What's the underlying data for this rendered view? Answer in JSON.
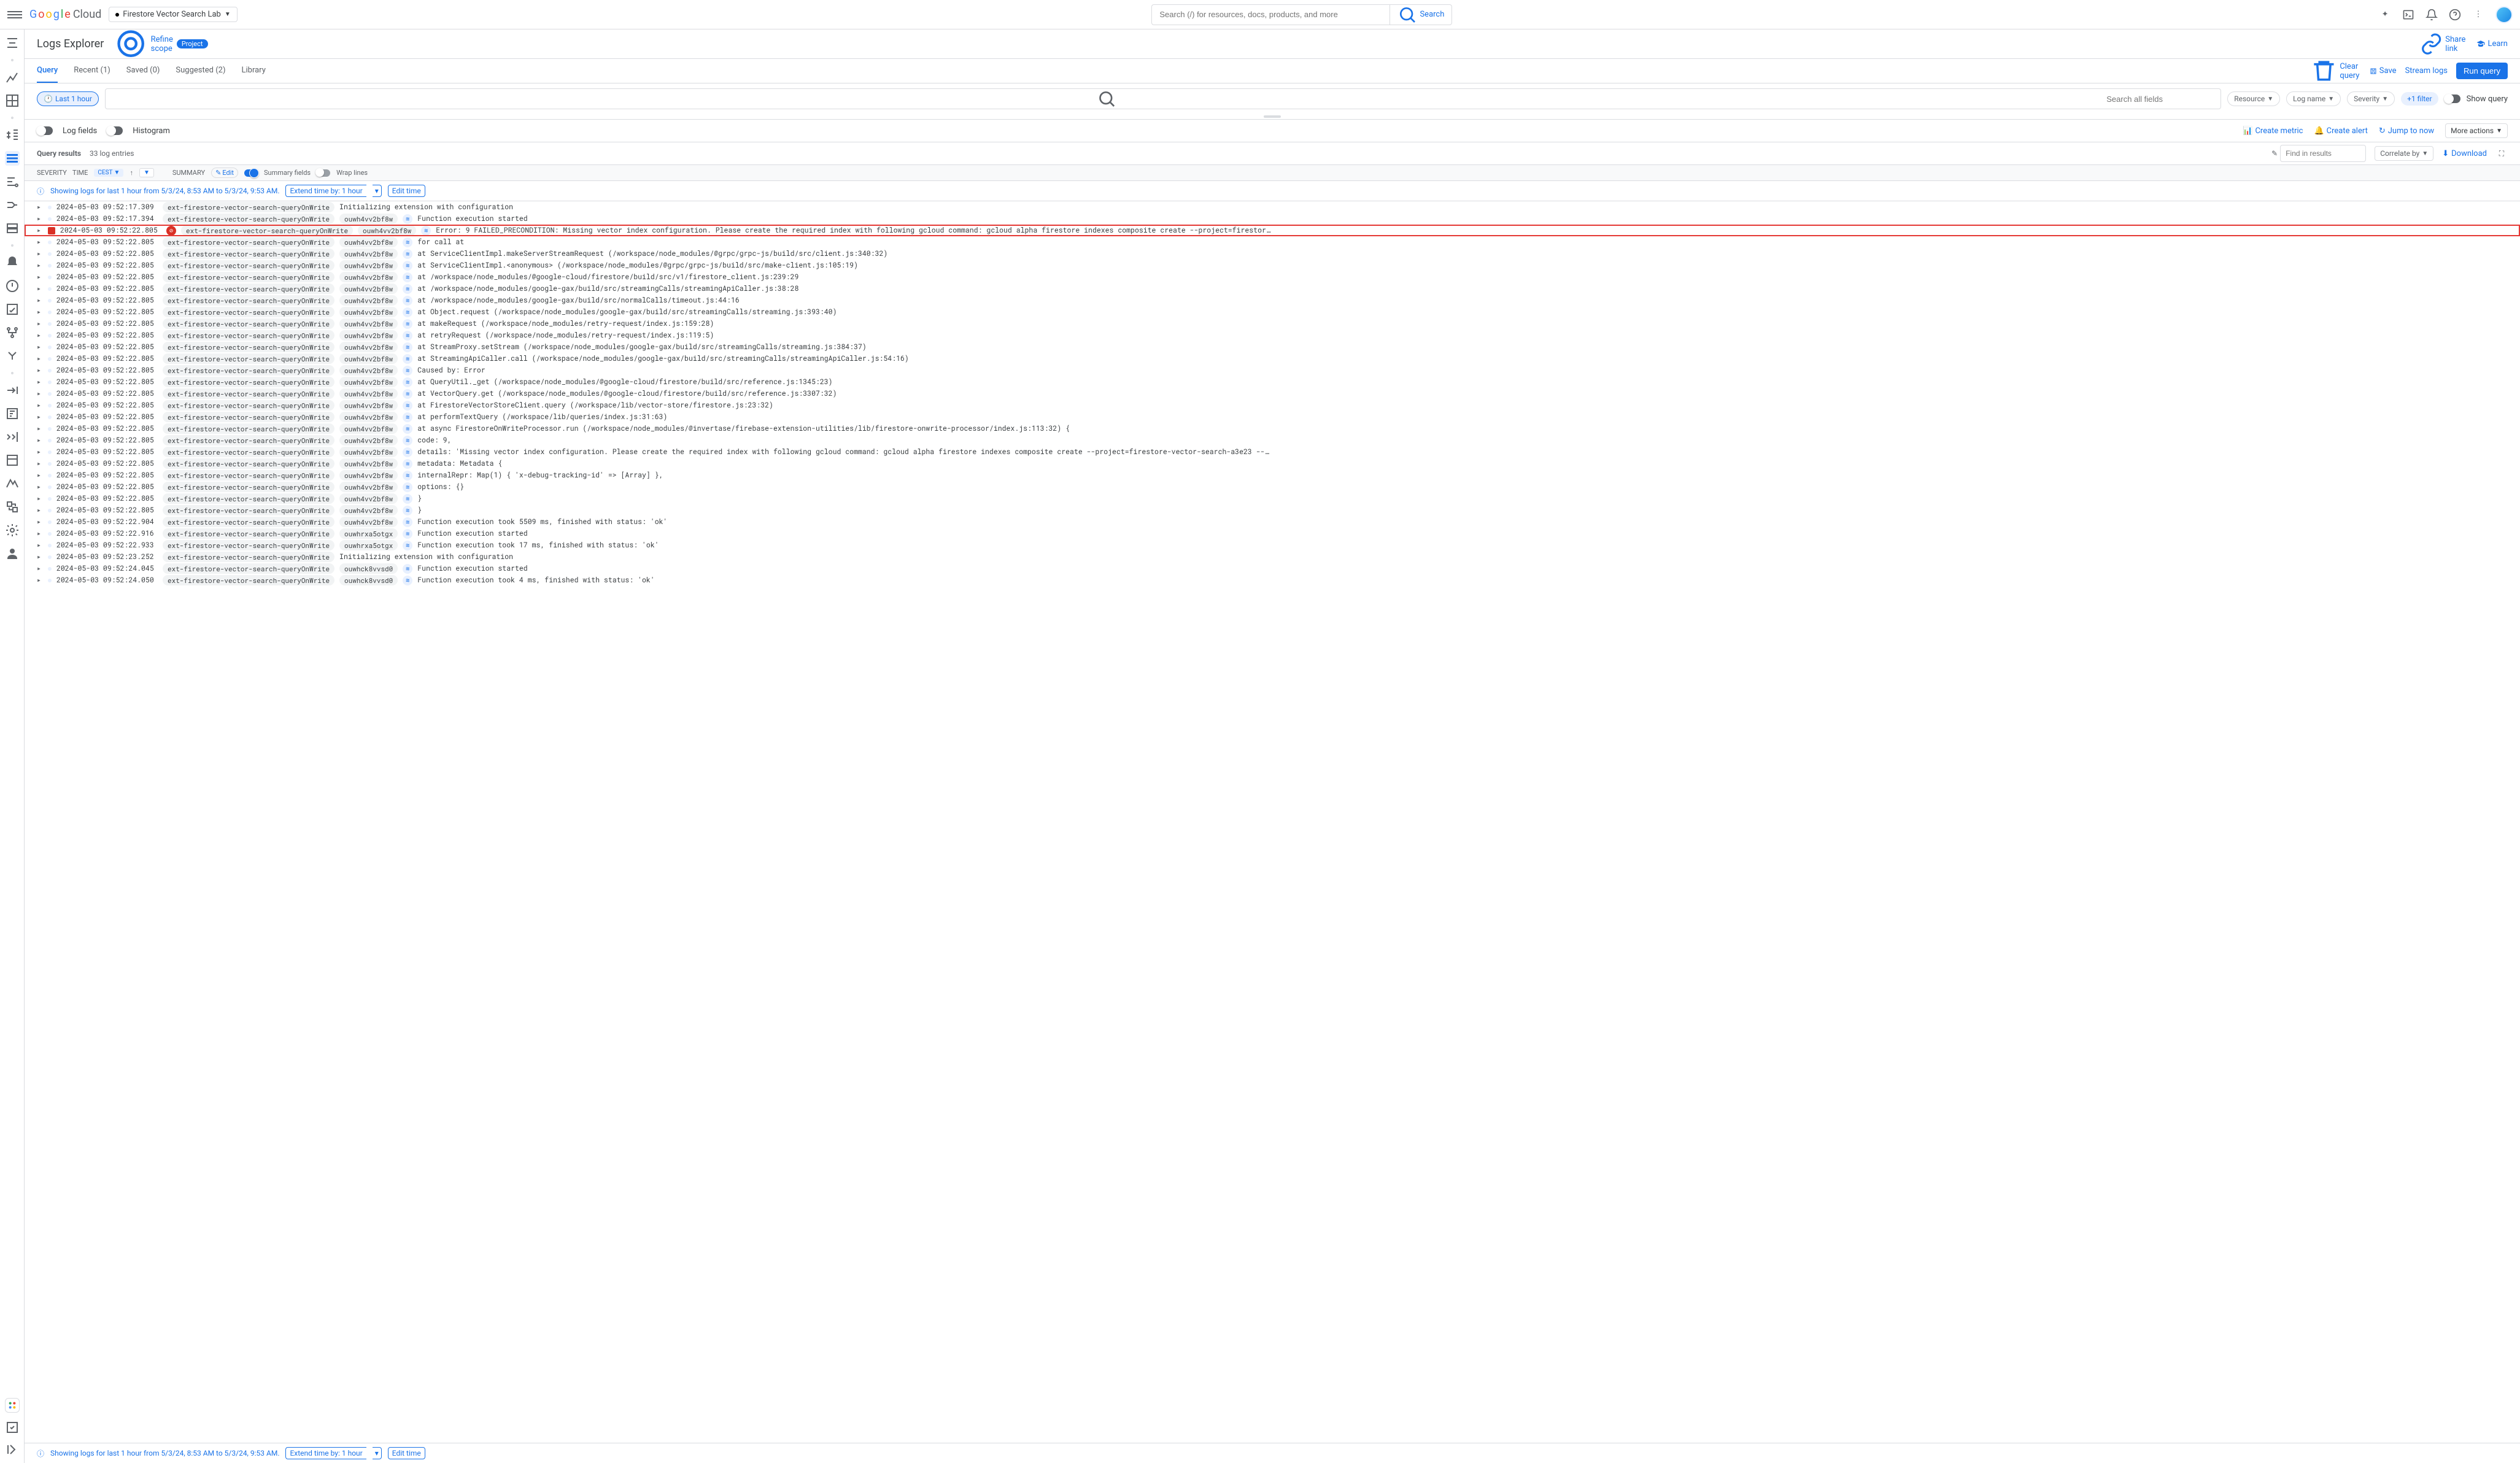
{
  "topbar": {
    "logo_cloud": "Cloud",
    "project_name": "Firestore Vector Search Lab",
    "search_placeholder": "Search (/) for resources, docs, products, and more",
    "search_button": "Search"
  },
  "subhead": {
    "title": "Logs Explorer",
    "refine": "Refine scope",
    "refine_chip": "Project",
    "share": "Share link",
    "learn": "Learn"
  },
  "tabs": {
    "query": "Query",
    "recent": "Recent (1)",
    "saved": "Saved (0)",
    "suggested": "Suggested (2)",
    "library": "Library",
    "clear": "Clear query",
    "save": "Save",
    "stream": "Stream logs",
    "run": "Run query"
  },
  "querybar": {
    "timerange": "Last 1 hour",
    "search_placeholder": "Search all fields",
    "resource": "Resource",
    "logname": "Log name",
    "severity": "Severity",
    "plusfilter": "+1 filter",
    "showquery": "Show query"
  },
  "panel": {
    "logfields": "Log fields",
    "histogram": "Histogram",
    "createmetric": "Create metric",
    "createalert": "Create alert",
    "jumptonow": "Jump to now",
    "moreactions": "More actions"
  },
  "resultbar": {
    "label": "Query results",
    "count": "33 log entries",
    "find_placeholder": "Find in results",
    "correlate": "Correlate by",
    "download": "Download"
  },
  "header": {
    "severity": "SEVERITY",
    "time": "TIME",
    "tz": "CEST",
    "summary": "SUMMARY",
    "edit": "Edit",
    "summaryfields": "Summary fields",
    "wraplines": "Wrap lines"
  },
  "banner": {
    "text": "Showing logs for last 1 hour from 5/3/24, 8:53 AM to 5/3/24, 9:53 AM.",
    "extend": "Extend time by: 1 hour",
    "edit": "Edit time"
  },
  "chips": {
    "fn": "ext-firestore-vector-search-queryOnWrite",
    "exec_a": "ouwh4vv2bf8w",
    "exec_b": "ouwhrxa5otgx",
    "exec_c": "ouwhck8vvsd0"
  },
  "logs": [
    {
      "sev": "info",
      "ts": "2024-05-03 09:52:17.309",
      "chips": [
        "fn"
      ],
      "msg": "Initializing extension with configuration"
    },
    {
      "sev": "debug",
      "ts": "2024-05-03 09:52:17.394",
      "chips": [
        "fn",
        "exec_a"
      ],
      "blue": true,
      "msg": "Function execution started"
    },
    {
      "sev": "err",
      "ts": "2024-05-03 09:52:22.805",
      "chips": [
        "fn",
        "exec_a"
      ],
      "blue": true,
      "err": true,
      "hl": true,
      "msg": "Error: 9 FAILED_PRECONDITION: Missing vector index configuration. Please create the required index with following gcloud command: gcloud alpha firestore indexes composite create --project=firestor…"
    },
    {
      "sev": "info",
      "ts": "2024-05-03 09:52:22.805",
      "chips": [
        "fn",
        "exec_a"
      ],
      "blue": true,
      "msg": "for call at"
    },
    {
      "sev": "info",
      "ts": "2024-05-03 09:52:22.805",
      "chips": [
        "fn",
        "exec_a"
      ],
      "blue": true,
      "msg": "    at ServiceClientImpl.makeServerStreamRequest (/workspace/node_modules/@grpc/grpc-js/build/src/client.js:340:32)"
    },
    {
      "sev": "info",
      "ts": "2024-05-03 09:52:22.805",
      "chips": [
        "fn",
        "exec_a"
      ],
      "blue": true,
      "msg": "    at ServiceClientImpl.<anonymous> (/workspace/node_modules/@grpc/grpc-js/build/src/make-client.js:105:19)"
    },
    {
      "sev": "info",
      "ts": "2024-05-03 09:52:22.805",
      "chips": [
        "fn",
        "exec_a"
      ],
      "blue": true,
      "msg": "    at /workspace/node_modules/@google-cloud/firestore/build/src/v1/firestore_client.js:239:29"
    },
    {
      "sev": "info",
      "ts": "2024-05-03 09:52:22.805",
      "chips": [
        "fn",
        "exec_a"
      ],
      "blue": true,
      "msg": "    at /workspace/node_modules/google-gax/build/src/streamingCalls/streamingApiCaller.js:38:28"
    },
    {
      "sev": "info",
      "ts": "2024-05-03 09:52:22.805",
      "chips": [
        "fn",
        "exec_a"
      ],
      "blue": true,
      "msg": "    at /workspace/node_modules/google-gax/build/src/normalCalls/timeout.js:44:16"
    },
    {
      "sev": "info",
      "ts": "2024-05-03 09:52:22.805",
      "chips": [
        "fn",
        "exec_a"
      ],
      "blue": true,
      "msg": "    at Object.request (/workspace/node_modules/google-gax/build/src/streamingCalls/streaming.js:393:40)"
    },
    {
      "sev": "info",
      "ts": "2024-05-03 09:52:22.805",
      "chips": [
        "fn",
        "exec_a"
      ],
      "blue": true,
      "msg": "    at makeRequest (/workspace/node_modules/retry-request/index.js:159:28)"
    },
    {
      "sev": "info",
      "ts": "2024-05-03 09:52:22.805",
      "chips": [
        "fn",
        "exec_a"
      ],
      "blue": true,
      "msg": "    at retryRequest (/workspace/node_modules/retry-request/index.js:119:5)"
    },
    {
      "sev": "info",
      "ts": "2024-05-03 09:52:22.805",
      "chips": [
        "fn",
        "exec_a"
      ],
      "blue": true,
      "msg": "    at StreamProxy.setStream (/workspace/node_modules/google-gax/build/src/streamingCalls/streaming.js:384:37)"
    },
    {
      "sev": "info",
      "ts": "2024-05-03 09:52:22.805",
      "chips": [
        "fn",
        "exec_a"
      ],
      "blue": true,
      "msg": "    at StreamingApiCaller.call (/workspace/node_modules/google-gax/build/src/streamingCalls/streamingApiCaller.js:54:16)"
    },
    {
      "sev": "info",
      "ts": "2024-05-03 09:52:22.805",
      "chips": [
        "fn",
        "exec_a"
      ],
      "blue": true,
      "msg": "Caused by: Error"
    },
    {
      "sev": "info",
      "ts": "2024-05-03 09:52:22.805",
      "chips": [
        "fn",
        "exec_a"
      ],
      "blue": true,
      "msg": "    at QueryUtil._get (/workspace/node_modules/@google-cloud/firestore/build/src/reference.js:1345:23)"
    },
    {
      "sev": "info",
      "ts": "2024-05-03 09:52:22.805",
      "chips": [
        "fn",
        "exec_a"
      ],
      "blue": true,
      "msg": "    at VectorQuery.get (/workspace/node_modules/@google-cloud/firestore/build/src/reference.js:3307:32)"
    },
    {
      "sev": "info",
      "ts": "2024-05-03 09:52:22.805",
      "chips": [
        "fn",
        "exec_a"
      ],
      "blue": true,
      "msg": "    at FirestoreVectorStoreClient.query (/workspace/lib/vector-store/firestore.js:23:32)"
    },
    {
      "sev": "info",
      "ts": "2024-05-03 09:52:22.805",
      "chips": [
        "fn",
        "exec_a"
      ],
      "blue": true,
      "msg": "    at performTextQuery (/workspace/lib/queries/index.js:31:63)"
    },
    {
      "sev": "info",
      "ts": "2024-05-03 09:52:22.805",
      "chips": [
        "fn",
        "exec_a"
      ],
      "blue": true,
      "msg": "    at async FirestoreOnWriteProcessor.run (/workspace/node_modules/@invertase/firebase-extension-utilities/lib/firestore-onwrite-processor/index.js:113:32) {"
    },
    {
      "sev": "info",
      "ts": "2024-05-03 09:52:22.805",
      "chips": [
        "fn",
        "exec_a"
      ],
      "blue": true,
      "msg": "  code: 9,"
    },
    {
      "sev": "info",
      "ts": "2024-05-03 09:52:22.805",
      "chips": [
        "fn",
        "exec_a"
      ],
      "blue": true,
      "msg": "  details: 'Missing vector index configuration. Please create the required index with following gcloud command: gcloud alpha firestore indexes composite create --project=firestore-vector-search-a3e23 --…"
    },
    {
      "sev": "info",
      "ts": "2024-05-03 09:52:22.805",
      "chips": [
        "fn",
        "exec_a"
      ],
      "blue": true,
      "msg": "  metadata: Metadata {"
    },
    {
      "sev": "info",
      "ts": "2024-05-03 09:52:22.805",
      "chips": [
        "fn",
        "exec_a"
      ],
      "blue": true,
      "msg": "    internalRepr: Map(1) { 'x-debug-tracking-id' => [Array] },"
    },
    {
      "sev": "info",
      "ts": "2024-05-03 09:52:22.805",
      "chips": [
        "fn",
        "exec_a"
      ],
      "blue": true,
      "msg": "    options: {}"
    },
    {
      "sev": "info",
      "ts": "2024-05-03 09:52:22.805",
      "chips": [
        "fn",
        "exec_a"
      ],
      "blue": true,
      "msg": "  }"
    },
    {
      "sev": "info",
      "ts": "2024-05-03 09:52:22.805",
      "chips": [
        "fn",
        "exec_a"
      ],
      "blue": true,
      "msg": "}"
    },
    {
      "sev": "debug",
      "ts": "2024-05-03 09:52:22.904",
      "chips": [
        "fn",
        "exec_a"
      ],
      "blue": true,
      "msg": "Function execution took 5509 ms, finished with status: 'ok'"
    },
    {
      "sev": "debug",
      "ts": "2024-05-03 09:52:22.916",
      "chips": [
        "fn",
        "exec_b"
      ],
      "blue": true,
      "msg": "Function execution started"
    },
    {
      "sev": "debug",
      "ts": "2024-05-03 09:52:22.933",
      "chips": [
        "fn",
        "exec_b"
      ],
      "blue": true,
      "msg": "Function execution took 17 ms, finished with status: 'ok'"
    },
    {
      "sev": "info",
      "ts": "2024-05-03 09:52:23.252",
      "chips": [
        "fn"
      ],
      "msg": "Initializing extension with configuration"
    },
    {
      "sev": "debug",
      "ts": "2024-05-03 09:52:24.045",
      "chips": [
        "fn",
        "exec_c"
      ],
      "blue": true,
      "msg": "Function execution started"
    },
    {
      "sev": "debug",
      "ts": "2024-05-03 09:52:24.050",
      "chips": [
        "fn",
        "exec_c"
      ],
      "blue": true,
      "msg": "Function execution took 4 ms, finished with status: 'ok'"
    }
  ]
}
